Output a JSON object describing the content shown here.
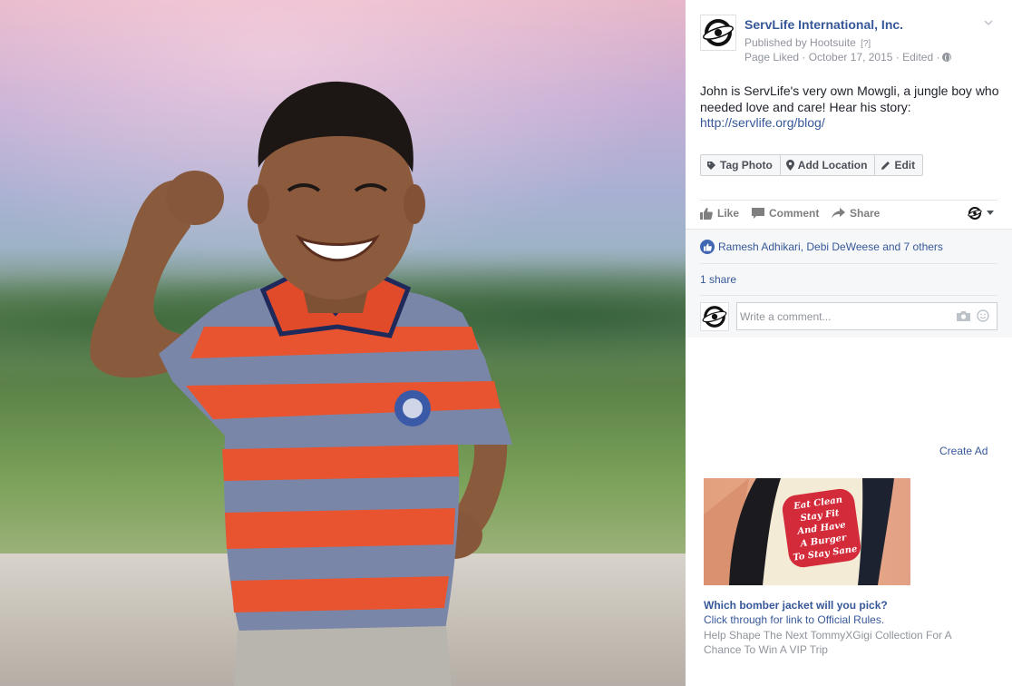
{
  "post": {
    "page_name": "ServLife International, Inc.",
    "publisher": "Published by Hootsuite",
    "publisher_help": "[?]",
    "meta": "Page Liked · October 17, 2015 · Edited ·",
    "text": "John is ServLife's very own Mowgli, a jungle boy who needed love and care! Hear his story:",
    "link": "http://servlife.org/blog/"
  },
  "photo_actions": [
    {
      "label": "Tag Photo",
      "icon": "tag-icon"
    },
    {
      "label": "Add Location",
      "icon": "location-pin-icon"
    },
    {
      "label": "Edit",
      "icon": "pencil-icon"
    }
  ],
  "ufi": {
    "like": "Like",
    "comment": "Comment",
    "share": "Share"
  },
  "feedback": {
    "reactions": "Ramesh Adhikari, Debi DeWeese and 7 others",
    "shares": "1 share",
    "comment_placeholder": "Write a comment..."
  },
  "ad": {
    "create_ad": "Create Ad",
    "title": "Which bomber jacket will you pick?",
    "subtitle": "Click through for link to Official Rules.",
    "description": "Help Shape The Next TommyXGigi Collection For A Chance To Win A VIP Trip",
    "patch_lines": [
      "Eat Clean",
      "Stay Fit",
      "And Have",
      "A Burger",
      "To Stay Sane"
    ]
  },
  "colors": {
    "link": "#365899",
    "muted": "#90949c",
    "like_badge": "#4267b2",
    "feedback_bg": "#f6f7f9"
  }
}
